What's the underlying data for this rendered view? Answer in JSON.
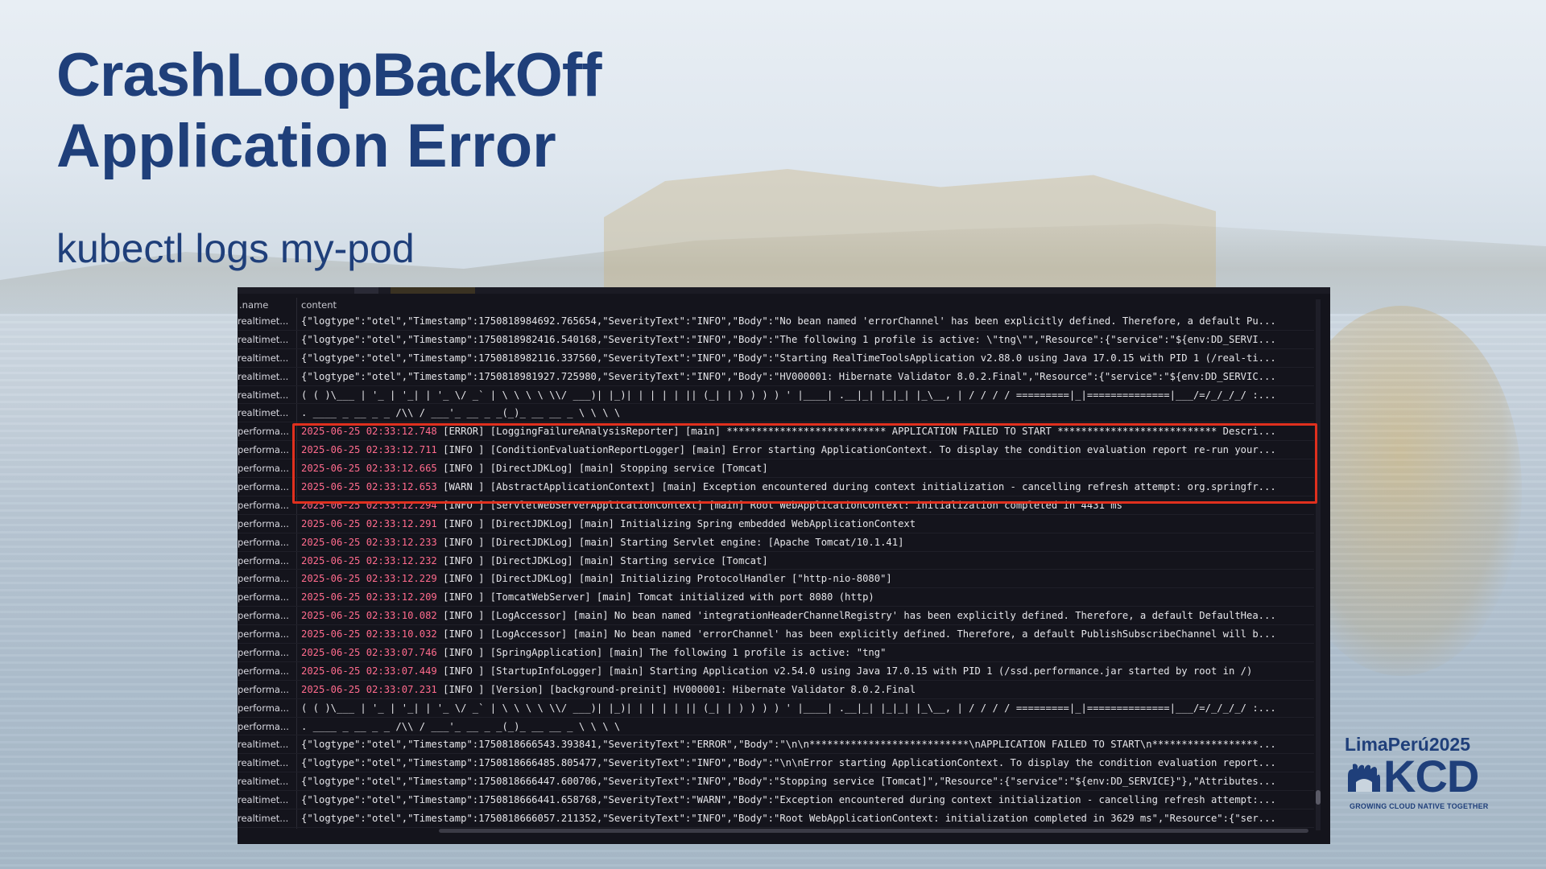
{
  "slide": {
    "title": "CrashLoopBackOff",
    "subtitle": "Application Error",
    "command": "kubectl logs my-pod"
  },
  "log_viewer": {
    "columns": [
      ".name",
      "content"
    ],
    "rows": [
      {
        "name": "realtimet...",
        "content": "{\"logtype\":\"otel\",\"Timestamp\":1750818984692.765654,\"SeverityText\":\"INFO\",\"Body\":\"No bean named 'errorChannel' has been explicitly defined. Therefore, a default Pu..."
      },
      {
        "name": "realtimet...",
        "content": "{\"logtype\":\"otel\",\"Timestamp\":1750818982416.540168,\"SeverityText\":\"INFO\",\"Body\":\"The following 1 profile is active: \\\"tng\\\"\",\"Resource\":{\"service\":\"${env:DD_SERVI..."
      },
      {
        "name": "realtimet...",
        "content": "{\"logtype\":\"otel\",\"Timestamp\":1750818982116.337560,\"SeverityText\":\"INFO\",\"Body\":\"Starting RealTimeToolsApplication v2.88.0 using Java 17.0.15 with PID 1 (/real-ti..."
      },
      {
        "name": "realtimet...",
        "content": "{\"logtype\":\"otel\",\"Timestamp\":1750818981927.725980,\"SeverityText\":\"INFO\",\"Body\":\"HV000001: Hibernate Validator 8.0.2.Final\",\"Resource\":{\"service\":\"${env:DD_SERVIC..."
      },
      {
        "name": "realtimet...",
        "content": "( ( )\\___ | '_ | '_| | '_ \\/ _` | \\ \\ \\ \\ \\\\/ ___)| |_)| | | | | || (_| | ) ) ) ) ' |____| .__|_| |_|_| |_\\__, | / / / / =========|_|==============|___/=/_/_/_/ :..."
      },
      {
        "name": "realtimet...",
        "content": ". ____ _ __ _ _ /\\\\ / ___'_ __ _ _(_)_ __ __ _ \\ \\ \\ \\"
      },
      {
        "name": "performa...",
        "ts": "2025-06-25 02:33:12.748",
        "content": " [ERROR] [LoggingFailureAnalysisReporter] [main] *************************** APPLICATION FAILED TO START *************************** Descri..."
      },
      {
        "name": "performa...",
        "ts": "2025-06-25 02:33:12.711",
        "content": " [INFO ] [ConditionEvaluationReportLogger] [main] Error starting ApplicationContext. To display the condition evaluation report re-run your..."
      },
      {
        "name": "performa...",
        "ts": "2025-06-25 02:33:12.665",
        "content": " [INFO ] [DirectJDKLog] [main] Stopping service [Tomcat]"
      },
      {
        "name": "performa...",
        "ts": "2025-06-25 02:33:12.653",
        "content": " [WARN ] [AbstractApplicationContext] [main] Exception encountered during context initialization - cancelling refresh attempt: org.springfr..."
      },
      {
        "name": "performa...",
        "ts": "2025-06-25 02:33:12.294",
        "content": " [INFO ] [ServletWebServerApplicationContext] [main] Root WebApplicationContext: initialization completed in 4431 ms"
      },
      {
        "name": "performa...",
        "ts": "2025-06-25 02:33:12.291",
        "content": " [INFO ] [DirectJDKLog] [main] Initializing Spring embedded WebApplicationContext"
      },
      {
        "name": "performa...",
        "ts": "2025-06-25 02:33:12.233",
        "content": " [INFO ] [DirectJDKLog] [main] Starting Servlet engine: [Apache Tomcat/10.1.41]"
      },
      {
        "name": "performa...",
        "ts": "2025-06-25 02:33:12.232",
        "content": " [INFO ] [DirectJDKLog] [main] Starting service [Tomcat]"
      },
      {
        "name": "performa...",
        "ts": "2025-06-25 02:33:12.229",
        "content": " [INFO ] [DirectJDKLog] [main] Initializing ProtocolHandler [\"http-nio-8080\"]"
      },
      {
        "name": "performa...",
        "ts": "2025-06-25 02:33:12.209",
        "content": " [INFO ] [TomcatWebServer] [main] Tomcat initialized with port 8080 (http)"
      },
      {
        "name": "performa...",
        "ts": "2025-06-25 02:33:10.082",
        "content": " [INFO ] [LogAccessor] [main] No bean named 'integrationHeaderChannelRegistry' has been explicitly defined. Therefore, a default DefaultHea..."
      },
      {
        "name": "performa...",
        "ts": "2025-06-25 02:33:10.032",
        "content": " [INFO ] [LogAccessor] [main] No bean named 'errorChannel' has been explicitly defined. Therefore, a default PublishSubscribeChannel will b..."
      },
      {
        "name": "performa...",
        "ts": "2025-06-25 02:33:07.746",
        "content": " [INFO ] [SpringApplication] [main] The following 1 profile is active: \"tng\""
      },
      {
        "name": "performa...",
        "ts": "2025-06-25 02:33:07.449",
        "content": " [INFO ] [StartupInfoLogger] [main] Starting Application v2.54.0 using Java 17.0.15 with PID 1 (/ssd.performance.jar started by root in /)"
      },
      {
        "name": "performa...",
        "ts": "2025-06-25 02:33:07.231",
        "content": " [INFO ] [Version] [background-preinit] HV000001: Hibernate Validator 8.0.2.Final"
      },
      {
        "name": "performa...",
        "content": "( ( )\\___ | '_ | '_| | '_ \\/ _` | \\ \\ \\ \\ \\\\/ ___)| |_)| | | | | || (_| | ) ) ) ) ' |____| .__|_| |_|_| |_\\__, | / / / / =========|_|==============|___/=/_/_/_/ :..."
      },
      {
        "name": "performa...",
        "content": ". ____ _ __ _ _ /\\\\ / ___'_ __ _ _(_)_ __ __ _ \\ \\ \\ \\"
      },
      {
        "name": "realtimet...",
        "content": "{\"logtype\":\"otel\",\"Timestamp\":1750818666543.393841,\"SeverityText\":\"ERROR\",\"Body\":\"\\n\\n***************************\\nAPPLICATION FAILED TO START\\n******************..."
      },
      {
        "name": "realtimet...",
        "content": "{\"logtype\":\"otel\",\"Timestamp\":1750818666485.805477,\"SeverityText\":\"INFO\",\"Body\":\"\\n\\nError starting ApplicationContext. To display the condition evaluation report..."
      },
      {
        "name": "realtimet...",
        "content": "{\"logtype\":\"otel\",\"Timestamp\":1750818666447.600706,\"SeverityText\":\"INFO\",\"Body\":\"Stopping service [Tomcat]\",\"Resource\":{\"service\":\"${env:DD_SERVICE}\"},\"Attributes..."
      },
      {
        "name": "realtimet...",
        "content": "{\"logtype\":\"otel\",\"Timestamp\":1750818666441.658768,\"SeverityText\":\"WARN\",\"Body\":\"Exception encountered during context initialization - cancelling refresh attempt:..."
      },
      {
        "name": "realtimet...",
        "content": "{\"logtype\":\"otel\",\"Timestamp\":1750818666057.211352,\"SeverityText\":\"INFO\",\"Body\":\"Root WebApplicationContext: initialization completed in 3629 ms\",\"Resource\":{\"ser..."
      }
    ]
  },
  "logo": {
    "event": "LimaPerú2025",
    "brand": "KCD",
    "tagline": "GROWING CLOUD NATIVE TOGETHER"
  },
  "colors": {
    "title_blue": "#1f3f7a",
    "highlight_red": "#e0301e",
    "timestamp_pink": "#ff6b8d",
    "terminal_bg": "#14141c"
  }
}
